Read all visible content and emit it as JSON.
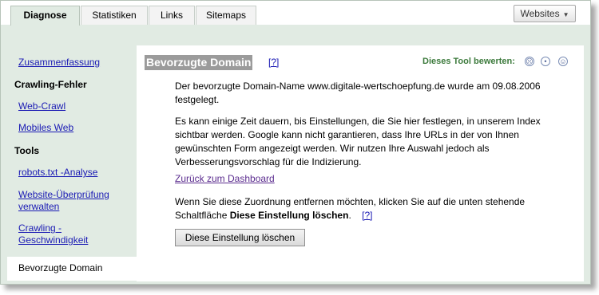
{
  "tabs": [
    {
      "label": "Diagnose",
      "active": true
    },
    {
      "label": "Statistiken",
      "active": false
    },
    {
      "label": "Links",
      "active": false
    },
    {
      "label": "Sitemaps",
      "active": false
    }
  ],
  "websites_button": {
    "label": "Websites",
    "icon": "chevron-down-icon"
  },
  "sidebar": {
    "summary": "Zusammenfassung",
    "crawl_errors_heading": "Crawling-Fehler",
    "web_crawl": "Web-Crawl",
    "mobile_web": "Mobiles Web",
    "tools_heading": "Tools",
    "robots": "robots.txt -Analyse",
    "site_verify": "Website-Überprüfung verwalten",
    "crawl_rate": "Crawling - Geschwindigkeit",
    "preferred_domain": "Bevorzugte Domain"
  },
  "content": {
    "title": "Bevorzugte Domain",
    "help": "[?]",
    "rate_label": "Dieses Tool bewerten:",
    "rate_icons": [
      "frown-icon",
      "neutral-face-icon",
      "smile-icon"
    ],
    "para1": "Der bevorzugte Domain-Name www.digitale-wertschoepfung.de wurde am 09.08.2006 festgelegt.",
    "para2": "Es kann einige Zeit dauern, bis Einstellungen, die Sie hier festlegen, in unserem Index sichtbar werden. Google kann nicht garantieren, dass Ihre URLs in der von Ihnen gewünschten Form angezeigt werden. Wir nutzen Ihre Auswahl jedoch als Verbesserungsvorschlag für die Indizierung.",
    "dashboard_link": "Zurück zum Dashboard",
    "para3_start": "Wenn Sie diese Zuordnung entfernen möchten, klicken Sie auf die unten stehende Schaltfläche ",
    "para3_bold": "Diese Einstellung löschen",
    "para3_end": ".",
    "help2": "[?]",
    "delete_button": "Diese Einstellung löschen"
  }
}
